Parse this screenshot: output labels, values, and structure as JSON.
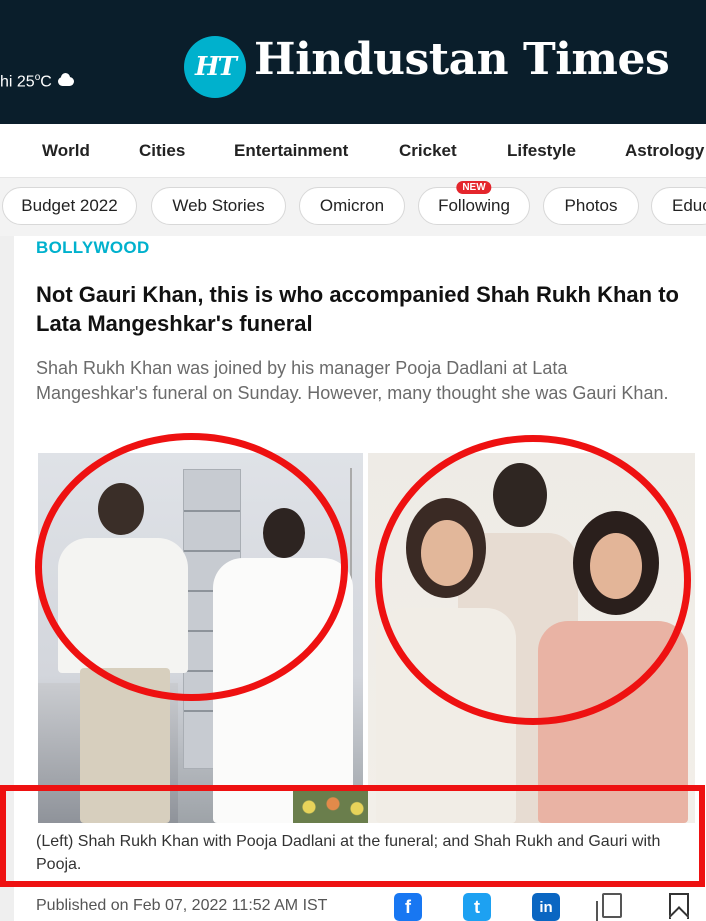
{
  "header": {
    "weather_city_fragment": "hi 25",
    "weather_degree": "o",
    "weather_unit": "C",
    "logo_mark": "HT",
    "logo_text": "Hindustan Times"
  },
  "nav": {
    "items": [
      "World",
      "Cities",
      "Entertainment",
      "Cricket",
      "Lifestyle",
      "Astrology"
    ]
  },
  "pills": {
    "items": [
      "Budget 2022",
      "Web Stories",
      "Omicron",
      "Following",
      "Photos",
      "Educ"
    ],
    "new_badge": "NEW"
  },
  "article": {
    "category": "BOLLYWOOD",
    "headline": "Not Gauri Khan, this is who accompanied Shah Rukh Khan to Lata Mangeshkar's funeral",
    "summary": "Shah Rukh Khan was joined by his manager Pooja Dadlani at Lata Mangeshkar's funeral on Sunday. However, many thought she was Gauri Khan.",
    "caption": "(Left) Shah Rukh Khan with Pooja Dadlani at the funeral; and Shah Rukh and Gauri with Pooja.",
    "published": "Published on Feb 07, 2022 11:52 AM IST"
  },
  "share": {
    "facebook_glyph": "f",
    "twitter_glyph": "t",
    "linkedin_glyph": "in"
  },
  "colors": {
    "header_bg": "#0a1e2b",
    "brand_cyan": "#00b1cd",
    "annotation_red": "#ee1111",
    "new_badge": "#e4252c"
  }
}
